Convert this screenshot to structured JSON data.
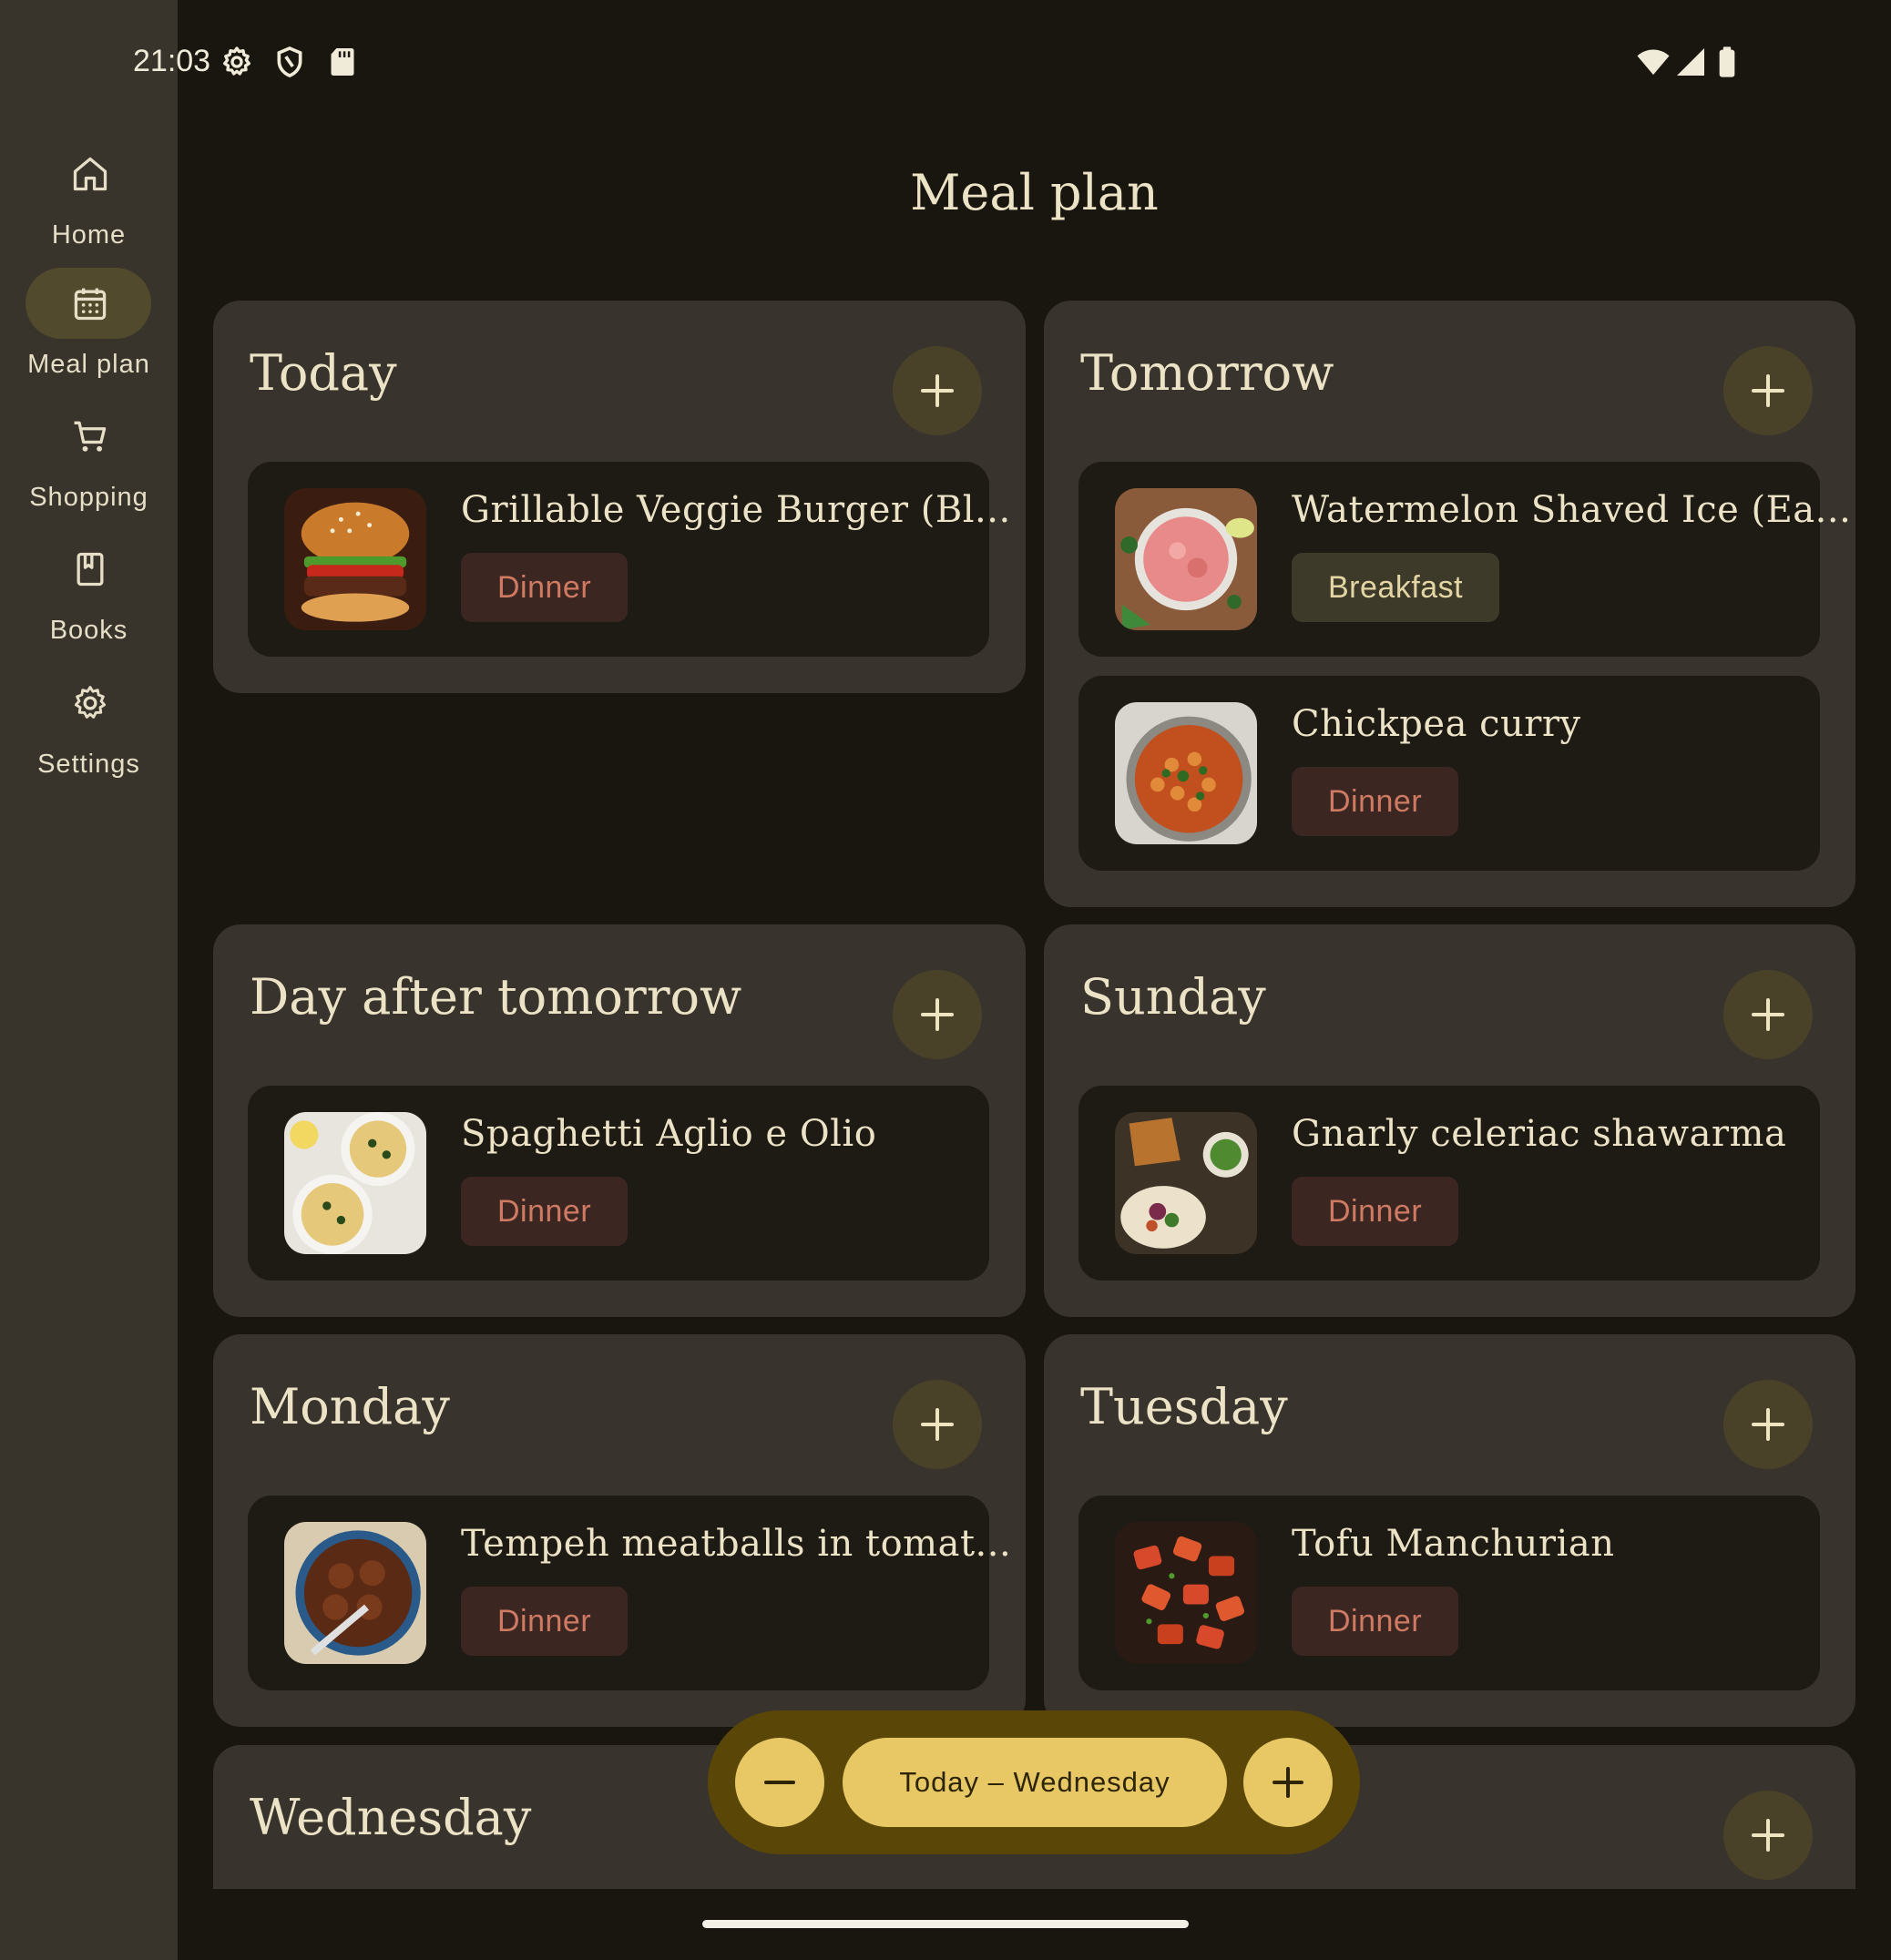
{
  "status_bar": {
    "time": "21:03",
    "left_icons": [
      "gear-icon",
      "shield-icon",
      "sd-card-icon"
    ],
    "right_icons": [
      "wifi-icon",
      "signal-icon",
      "battery-icon"
    ]
  },
  "nav": {
    "items": [
      {
        "label": "Home",
        "icon": "home-icon",
        "active": false
      },
      {
        "label": "Meal plan",
        "icon": "calendar-icon",
        "active": true
      },
      {
        "label": "Shopping",
        "icon": "cart-icon",
        "active": false
      },
      {
        "label": "Books",
        "icon": "book-icon",
        "active": false
      },
      {
        "label": "Settings",
        "icon": "settings-icon",
        "active": false
      }
    ]
  },
  "page": {
    "title": "Meal plan"
  },
  "days": [
    {
      "title": "Today",
      "meals": [
        {
          "name": "Grillable Veggie Burger (Bl...",
          "tag": "Dinner",
          "image": "burger"
        }
      ]
    },
    {
      "title": "Tomorrow",
      "meals": [
        {
          "name": "Watermelon Shaved Ice (Ea...",
          "tag": "Breakfast",
          "image": "watermelon"
        },
        {
          "name": "Chickpea curry",
          "tag": "Dinner",
          "image": "curry"
        }
      ]
    },
    {
      "title": "Day after tomorrow",
      "meals": [
        {
          "name": "Spaghetti Aglio e Olio",
          "tag": "Dinner",
          "image": "spaghetti"
        }
      ]
    },
    {
      "title": "Sunday",
      "meals": [
        {
          "name": "Gnarly celeriac shawarma",
          "tag": "Dinner",
          "image": "shawarma"
        }
      ]
    },
    {
      "title": "Monday",
      "meals": [
        {
          "name": "Tempeh meatballs in tomat...",
          "tag": "Dinner",
          "image": "meatballs"
        }
      ]
    },
    {
      "title": "Tuesday",
      "meals": [
        {
          "name": "Tofu Manchurian",
          "tag": "Dinner",
          "image": "tofu"
        }
      ]
    },
    {
      "title": "Wednesday",
      "meals": []
    }
  ],
  "range": {
    "label": "Today – Wednesday"
  },
  "colors": {
    "background": "#19160f",
    "rail": "#38332b",
    "card": "#38332c",
    "accent": "#e8c865",
    "dinner_tag": "#cf7a62"
  }
}
